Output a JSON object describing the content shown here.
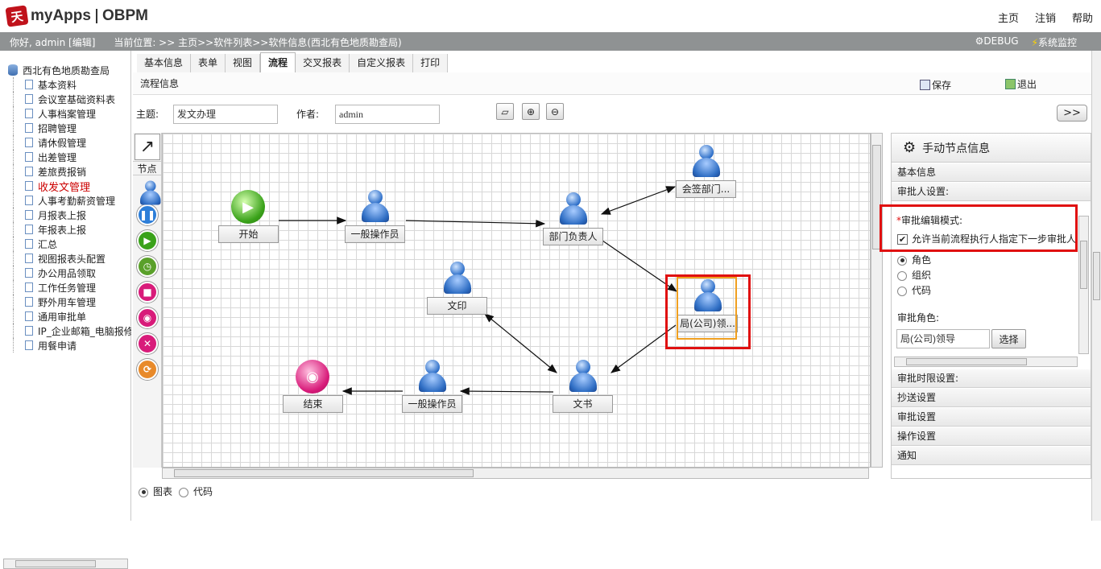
{
  "app": {
    "brand": "myApps",
    "product": "OBPM",
    "logo_glyph": "天"
  },
  "topnav": {
    "home": "主页",
    "logout": "注销",
    "help": "帮助"
  },
  "userbar": {
    "greeting": "你好, admin [编辑]",
    "location": "当前位置: >> 主页>>软件列表>>软件信息(西北有色地质勘查局)",
    "debug": "DEBUG",
    "monitor": "系统监控"
  },
  "tree": {
    "root": "西北有色地质勘查局",
    "items": [
      "基本资料",
      "会议室基础资料表",
      "人事档案管理",
      "招聘管理",
      "请休假管理",
      "出差管理",
      "差旅费报销",
      "收发文管理",
      "人事考勤薪资管理",
      "月报表上报",
      "年报表上报",
      "汇总",
      "视图报表头配置",
      "办公用品领取",
      "工作任务管理",
      "野外用车管理",
      "通用审批单",
      "IP_企业邮箱_电脑报修",
      "用餐申请"
    ],
    "active_index": 7
  },
  "tabs": [
    "基本信息",
    "表单",
    "视图",
    "流程",
    "交叉报表",
    "自定义报表",
    "打印"
  ],
  "selected_tab": 3,
  "page": {
    "title": "流程信息",
    "save": "保存",
    "exit": "退出"
  },
  "form": {
    "subject_label": "主题:",
    "subject_value": "发文办理",
    "author_label": "作者:",
    "author_value": "admin",
    "expand": ">>"
  },
  "toolbox": {
    "pointer": "↗",
    "node_label": "节点"
  },
  "flow": {
    "nodes": {
      "start": "开始",
      "op1": "一般操作员",
      "dept": "部门负责人",
      "cosign": "会签部门...",
      "bureau": "局(公司)领...",
      "print": "文印",
      "clerk": "文书",
      "op2": "一般操作员",
      "end": "结束"
    }
  },
  "panel": {
    "title": "手动节点信息",
    "sections_top": [
      "基本信息",
      "审批人设置:"
    ],
    "edit_mode_label": "审批编辑模式:",
    "allow_label": "允许当前流程执行人指定下一步审批人",
    "options": [
      "角色",
      "组织",
      "代码"
    ],
    "selected_option": 0,
    "role_label": "审批角色:",
    "role_value": "局(公司)领导",
    "choose_btn": "选择",
    "sections_bottom": [
      "审批时限设置:",
      "抄送设置",
      "审批设置",
      "操作设置",
      "通知"
    ]
  },
  "bottom": {
    "chart": "图表",
    "code": "代码"
  },
  "colors": {
    "highlight": "#e01010",
    "selected_node": "#f0a020",
    "active_tree": "#cc0000"
  }
}
